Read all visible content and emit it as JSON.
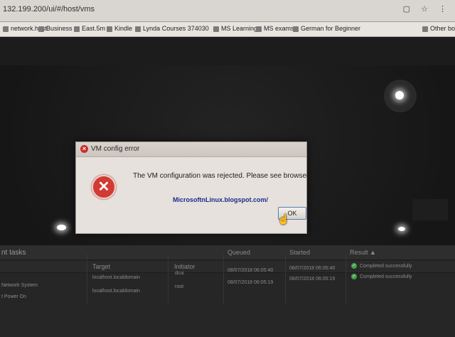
{
  "browser": {
    "url": "132.199.200/ui/#/host/vms",
    "bookmarks": [
      {
        "label": "network.host"
      },
      {
        "label": "Business"
      },
      {
        "label": "East.5m"
      },
      {
        "label": "Kindle"
      },
      {
        "label": "Lynda Courses 374030"
      },
      {
        "label": "MS Learning"
      },
      {
        "label": "MS exams"
      },
      {
        "label": "German for Beginner"
      },
      {
        "label": "Other boo"
      }
    ]
  },
  "dialog": {
    "title": "VM config error",
    "message": "The VM configuration was rejected. Please see browser Console",
    "watermark_main": "MicrosoftnLinux.blogspot.com/",
    "ok_label": "OK"
  },
  "tasks": {
    "panel_title": "nt tasks",
    "columns": [
      "Target",
      "Initiator",
      "Queued",
      "Started",
      "Result ▲"
    ],
    "rows": [
      {
        "name": "Network System",
        "target": "localhost.localdomain",
        "initiator": "dcui",
        "queued": "08/07/2018 06:05:40",
        "started": "08/07/2018 06:05:40",
        "result": "Completed successfully"
      },
      {
        "name": "t Power On",
        "target": "localhost.localdomain",
        "initiator": "root",
        "queued": "08/07/2018 06:05:19",
        "started": "08/07/2018 06:05:19",
        "result": "Completed successfully"
      }
    ]
  },
  "colors": {
    "error_red": "#d23a33",
    "dialog_bg": "#e6e1dc",
    "success_green": "#3fa24a",
    "watermark_blue": "#1b2d8c"
  },
  "icons": [
    "error-icon",
    "check-icon",
    "mouse-cursor-icon"
  ]
}
